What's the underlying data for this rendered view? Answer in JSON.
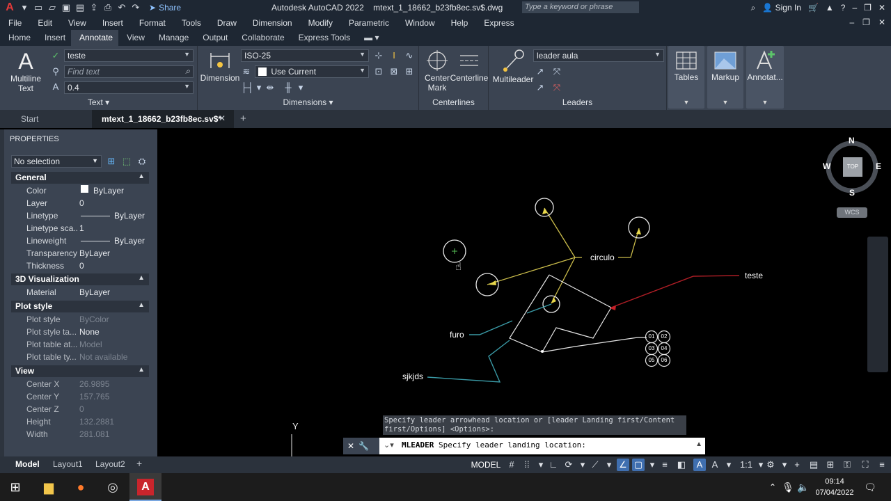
{
  "titlebar": {
    "share": "Share",
    "app_title": "Autodesk AutoCAD 2022",
    "file_name": "mtext_1_18662_b23fb8ec.sv$.dwg",
    "search_placeholder": "Type a keyword or phrase",
    "sign_in": "Sign In"
  },
  "menu": [
    "File",
    "Edit",
    "View",
    "Insert",
    "Format",
    "Tools",
    "Draw",
    "Dimension",
    "Modify",
    "Parametric",
    "Window",
    "Help",
    "Express"
  ],
  "ribbon_tabs": [
    "Home",
    "Insert",
    "Annotate",
    "View",
    "Manage",
    "Output",
    "Collaborate",
    "Express Tools"
  ],
  "ribbon": {
    "text": {
      "big_label_1": "Multiline",
      "big_label_2": "Text",
      "style_value": "teste",
      "find_placeholder": "Find text",
      "height_value": "0.4",
      "title": "Text"
    },
    "dimensions": {
      "big_label": "Dimension",
      "style_value": "ISO-25",
      "layer_value": "Use Current",
      "title": "Dimensions"
    },
    "centerlines": {
      "center_mark_1": "Center",
      "center_mark_2": "Mark",
      "centerline": "Centerline",
      "title": "Centerlines"
    },
    "leaders": {
      "big_label": "Multileader",
      "style_value": "leader aula",
      "title": "Leaders"
    },
    "tables": "Tables",
    "markup": "Markup",
    "annotation": "Annotat..."
  },
  "doc_tabs": {
    "start": "Start",
    "active": "mtext_1_18662_b23fb8ec.sv$*"
  },
  "properties": {
    "title": "PROPERTIES",
    "selection": "No selection",
    "sections": {
      "general": "General",
      "viz3d": "3D Visualization",
      "plot": "Plot style",
      "view": "View"
    },
    "general_rows": [
      {
        "k": "Color",
        "v": "ByLayer"
      },
      {
        "k": "Layer",
        "v": "0"
      },
      {
        "k": "Linetype",
        "v": "ByLayer"
      },
      {
        "k": "Linetype sca...",
        "v": "1"
      },
      {
        "k": "Lineweight",
        "v": "ByLayer"
      },
      {
        "k": "Transparency",
        "v": "ByLayer"
      },
      {
        "k": "Thickness",
        "v": "0"
      }
    ],
    "viz_rows": [
      {
        "k": "Material",
        "v": "ByLayer"
      }
    ],
    "plot_rows": [
      {
        "k": "Plot style",
        "v": "ByColor"
      },
      {
        "k": "Plot style ta...",
        "v": "None"
      },
      {
        "k": "Plot table at...",
        "v": "Model"
      },
      {
        "k": "Plot table ty...",
        "v": "Not available"
      }
    ],
    "view_rows": [
      {
        "k": "Center X",
        "v": "26.9895"
      },
      {
        "k": "Center Y",
        "v": "157.765"
      },
      {
        "k": "Center Z",
        "v": "0"
      },
      {
        "k": "Height",
        "v": "132.2881"
      },
      {
        "k": "Width",
        "v": "281.081"
      }
    ]
  },
  "viewcube": {
    "n": "N",
    "s": "S",
    "e": "E",
    "w": "W",
    "top": "TOP",
    "wcs": "WCS"
  },
  "drawing_labels": {
    "circulo": "circulo",
    "teste": "teste",
    "furo": "furo",
    "sjkjds": "sjkjds",
    "balloons": [
      "01",
      "02",
      "03",
      "04",
      "05",
      "06"
    ],
    "ucs_y": "Y"
  },
  "command": {
    "history_1": "Specify leader arrowhead location or [leader Landing first/Content",
    "history_2": "first/Options] <Options>:",
    "prompt_cmd": "MLEADER",
    "prompt_text": "Specify leader landing location:"
  },
  "layout_tabs": [
    "Model",
    "Layout1",
    "Layout2"
  ],
  "status": {
    "model": "MODEL",
    "scale": "1:1"
  },
  "clock": {
    "time": "09:14",
    "date": "07/04/2022"
  },
  "colors": {
    "ribbon_bg": "#3b4452",
    "title_bg": "#1e2733",
    "leader_yellow": "#cbbd4b",
    "leader_red": "#b01e26",
    "leader_teal": "#3a9aa6"
  }
}
